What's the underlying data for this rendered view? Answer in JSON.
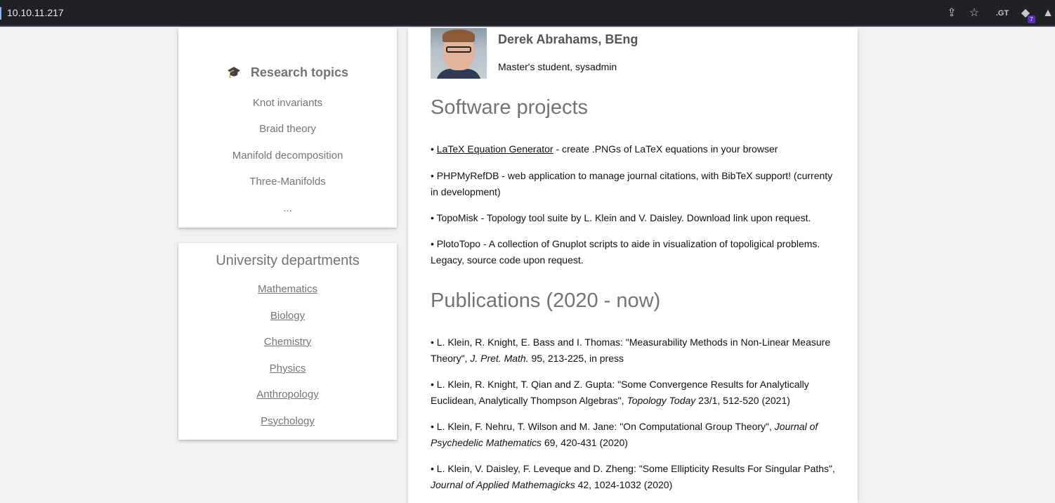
{
  "browser": {
    "url": "10.10.11.217",
    "extension_badge": "7"
  },
  "research": {
    "title": "Research topics",
    "items": [
      "Knot invariants",
      "Braid theory",
      "Manifold decomposition",
      "Three-Manifolds",
      "..."
    ]
  },
  "departments": {
    "title": "University departments",
    "items": [
      "Mathematics",
      "Biology",
      "Chemistry",
      "Physics",
      "Anthropology",
      "Psychology"
    ]
  },
  "profile": {
    "name": "Derek Abrahams, BEng",
    "role": "Master's student, sysadmin"
  },
  "software": {
    "title": "Software projects",
    "items": [
      {
        "bullet": "•",
        "link": "LaTeX Equation Generator",
        "text": " - create .PNGs of LaTeX equations in your browser"
      },
      {
        "bullet": "•",
        "text": "PHPMyRefDB - web application to manage journal citations, with BibTeX support! (currenty in development)"
      },
      {
        "bullet": "•",
        "text": "TopoMisk - Topology tool suite by L. Klein and V. Daisley. Download link upon request."
      },
      {
        "bullet": "•",
        "text": "PlotoTopo - A collection of Gnuplot scripts to aide in visualization of topoligical problems. Legacy, source code upon request."
      }
    ]
  },
  "publications": {
    "title": "Publications (2020 - now)",
    "items": [
      {
        "bullet": "•",
        "pre": "L. Klein, R. Knight, E. Bass and I. Thomas: \"Measurability Methods in Non-Linear Measure Theory\", ",
        "journal": "J. Pret. Math.",
        "post": " 95, 213-225, in press"
      },
      {
        "bullet": "•",
        "pre": "L. Klein, R. Knight, T. Qian and Z. Gupta: \"Some Convergence Results for Analytically Euclidean, Analytically Thompson Algebras\", ",
        "journal": "Topology Today",
        "post": " 23/1, 512-520 (2021)"
      },
      {
        "bullet": "•",
        "pre": "L. Klein, F. Nehru, T. Wilson and M. Jane: \"On Computational Group Theory\", ",
        "journal": "Journal of Psychedelic Mathematics",
        "post": " 69, 420-431 (2020)"
      },
      {
        "bullet": "•",
        "pre": "L. Klein, V. Daisley, F. Leveque and D. Zheng: \"Some Ellipticity Results For Singular Paths\", ",
        "journal": "Journal of Applied Mathemagicks",
        "post": " 42, 1024-1032 (2020)"
      }
    ]
  }
}
